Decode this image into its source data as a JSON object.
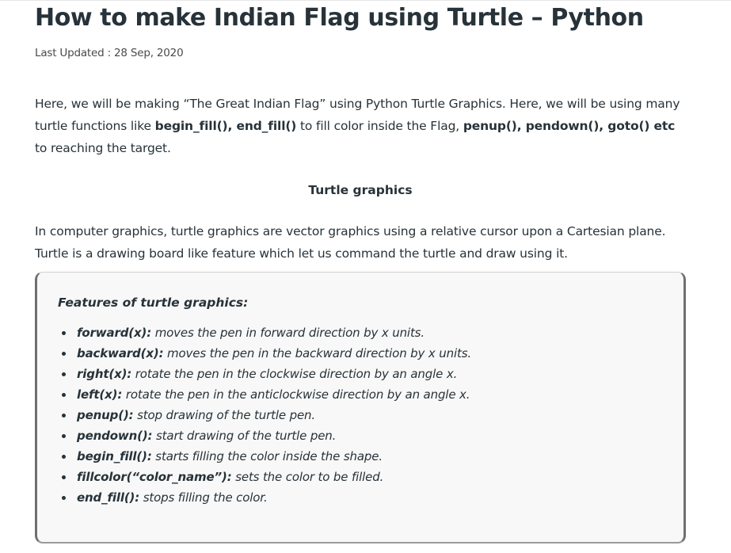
{
  "article": {
    "title": "How to make Indian Flag using Turtle – Python",
    "last_updated": "Last Updated : 28 Sep, 2020",
    "intro": {
      "t1": "Here, we will be making “The Great Indian Flag” using Python Turtle Graphics. Here, we will be using many turtle functions like ",
      "b1": "begin_fill(), end_fill()",
      "t2": " to fill color inside the Flag, ",
      "b2": "penup(), pendown(), goto() etc",
      "t3": " to reaching the target."
    },
    "subheading": "Turtle graphics",
    "description": "In computer graphics, turtle graphics are vector graphics using a relative cursor upon a Cartesian plane. Turtle is a drawing board like feature which let us command the turtle and draw using it."
  },
  "features": {
    "title": "Features of turtle graphics:",
    "items": [
      {
        "term": "forward(x):",
        "desc": " moves the pen in forward direction by x units."
      },
      {
        "term": "backward(x):",
        "desc": " moves the pen in the backward direction by x units."
      },
      {
        "term": "right(x):",
        "desc": " rotate the pen in the clockwise direction by an angle x."
      },
      {
        "term": "left(x):",
        "desc": " rotate the pen in the anticlockwise direction by an angle x."
      },
      {
        "term": "penup():",
        "desc": " stop drawing of the turtle pen."
      },
      {
        "term": "pendown():",
        "desc": " start drawing of the turtle pen."
      },
      {
        "term": "begin_fill():",
        "desc": " starts filling the color inside the shape."
      },
      {
        "term": "fillcolor(“color_name”):",
        "desc": " sets the color to be filled."
      },
      {
        "term": "end_fill():",
        "desc": " stops filling the color."
      }
    ]
  }
}
